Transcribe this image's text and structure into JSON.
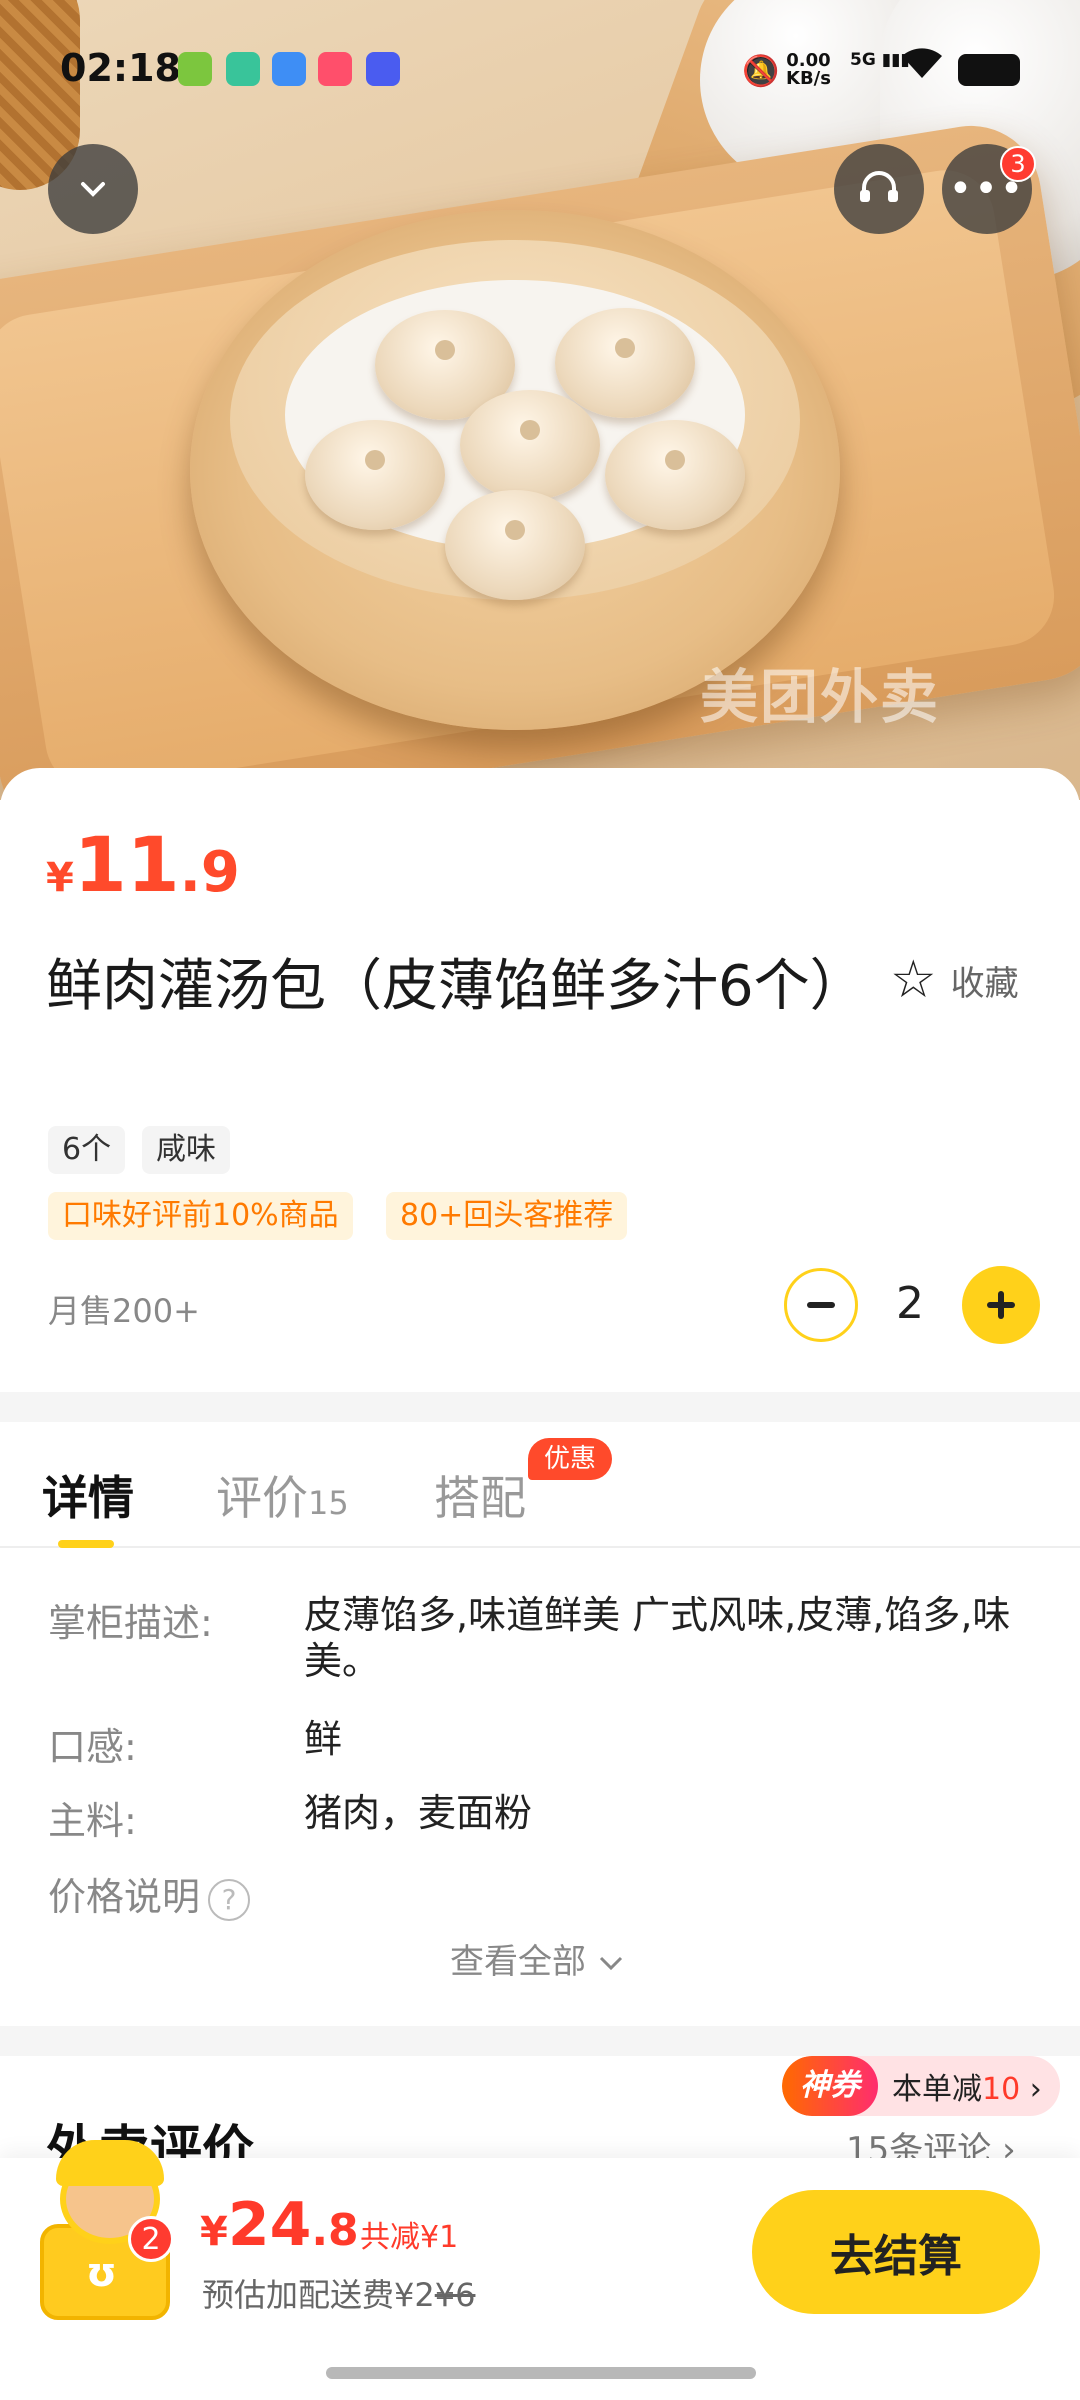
{
  "status_bar": {
    "time": "02:18",
    "net_speed_value": "0.00",
    "net_speed_unit": "KB/s",
    "network": "5G"
  },
  "hero": {
    "watermark": "美团外卖"
  },
  "header": {
    "more_badge": "3"
  },
  "product": {
    "price_symbol": "¥",
    "price_int": "11",
    "price_dec": ".9",
    "title": "鲜肉灌汤包（皮薄馅鲜多汁6个）",
    "favorite_label": "收藏",
    "specs": [
      "6个",
      "咸味"
    ],
    "tags": [
      "口味好评前10%商品",
      "80+回头客推荐"
    ],
    "monthly_sales": "月售200+",
    "quantity": "2"
  },
  "tabs": {
    "detail": "详情",
    "reviews": "评价",
    "reviews_count": "15",
    "combo": "搭配",
    "combo_badge": "优惠"
  },
  "details": {
    "rows": [
      {
        "label": "掌柜描述:",
        "value": "皮薄馅多,味道鲜美 广式风味,皮薄,馅多,味美。"
      },
      {
        "label": "口感:",
        "value": "鲜"
      },
      {
        "label": "主料:",
        "value": "猪肉，麦面粉"
      }
    ],
    "price_note": "价格说明",
    "view_all": "查看全部"
  },
  "reviews_section": {
    "title": "外卖评价",
    "coupon_tag": "神券",
    "coupon_text_prefix": "本单减",
    "coupon_amount": "10",
    "review_count": "15条评论"
  },
  "cart": {
    "count": "2",
    "total_symbol": "¥",
    "total_int": "24",
    "total_dec": ".8",
    "saved": "共减¥1",
    "fee_prefix": "预估加配送费¥2",
    "fee_original": "¥6",
    "checkout_label": "去结算"
  },
  "colors": {
    "accent_yellow": "#ffd11a",
    "price_red": "#ff4a2b"
  }
}
